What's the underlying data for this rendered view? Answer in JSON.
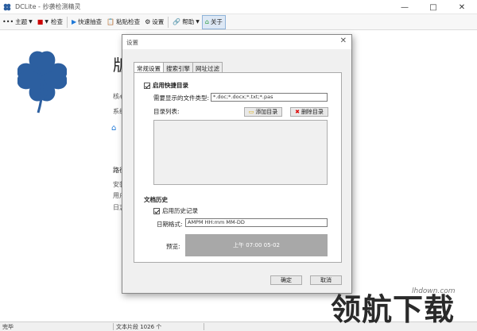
{
  "window": {
    "title": "DCLite - 抄袭检测精灵",
    "minimize": "—",
    "maximize": "□",
    "close": "✕"
  },
  "toolbar": {
    "theme": "主题",
    "check": "检查",
    "quick_sample": "快速抽查",
    "paste_check": "粘贴检查",
    "settings": "设置",
    "help": "帮助",
    "about": "关于"
  },
  "background": {
    "heading": "版",
    "line1": "核心",
    "line2": "系统",
    "section": "路径",
    "item1": "安装",
    "item2": "用户",
    "item3": "日志"
  },
  "dialog": {
    "title": "设置",
    "tabs": [
      "常规设置",
      "搜索引擎",
      "网址过滤"
    ],
    "quick_dir": {
      "enable_label": "启用快捷目录",
      "file_types_label": "需要显示的文件类型:",
      "file_types_value": "*.doc;*.docx;*.txt;*.pas",
      "dir_list_label": "目录列表:",
      "add_button": "添加目录",
      "delete_button": "删除目录"
    },
    "history": {
      "section_title": "文档历史",
      "enable_label": "启用历史记录",
      "date_format_label": "日期格式:",
      "date_format_value": "AMPM HH:mm MM-DD",
      "preview_label": "预览:",
      "preview_value": "上午 07:00 05-02"
    },
    "ok_button": "确定",
    "cancel_button": "取消"
  },
  "statusbar": {
    "left": "完毕",
    "middle": "文本片段 1026 个"
  },
  "watermark": {
    "url": "lhdown.com",
    "text": "领航下载"
  },
  "colors": {
    "clover": "#2c5fa0",
    "accent": "#1e78d7",
    "preview_bg": "#a8a8a8"
  }
}
